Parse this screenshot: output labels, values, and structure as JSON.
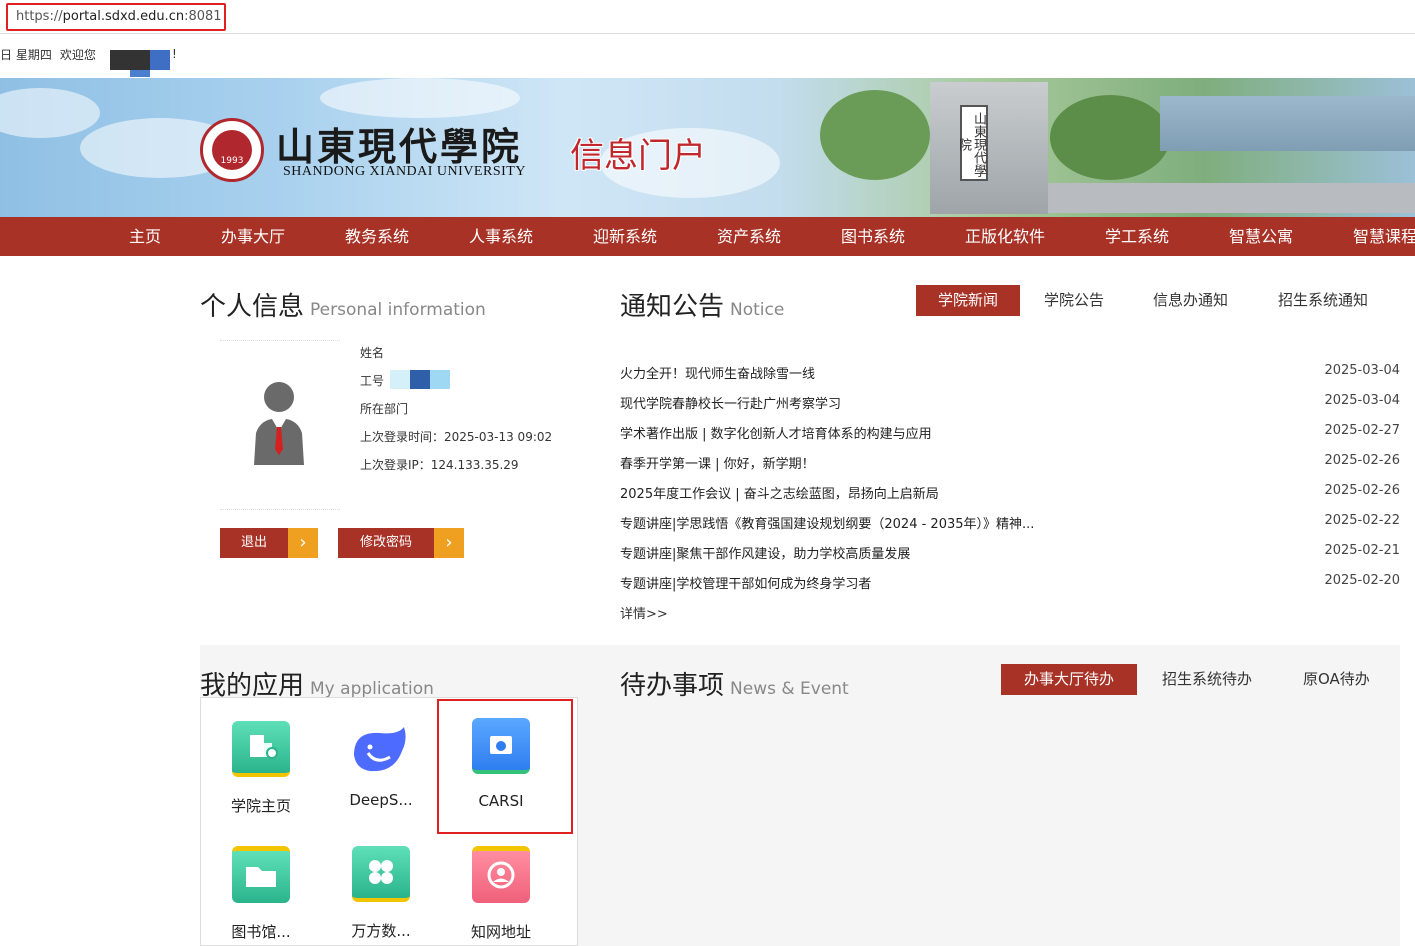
{
  "browser": {
    "url_scheme": "https://",
    "url_host": "portal.sdxd.edu.cn",
    "url_port": ":8081"
  },
  "welcome": {
    "weekday": "日 星期四",
    "greeting": "欢迎您",
    "exclaim": "!"
  },
  "banner": {
    "school_cn": "山東現代學院",
    "school_en": "SHANDONG XIANDAI UNIVERSITY",
    "seal_year": "1993",
    "portal_title": "信息门户",
    "gate_plaque": "山東現代學院"
  },
  "nav": [
    "主页",
    "办事大厅",
    "教务系统",
    "人事系统",
    "迎新系统",
    "资产系统",
    "图书系统",
    "正版化软件",
    "学工系统",
    "智慧公寓",
    "智慧课程"
  ],
  "personal": {
    "title": "个人信息",
    "title_en": "Personal information",
    "name_label": "姓名",
    "id_label": "工号",
    "dept_label": "所在部门",
    "last_login_time": "上次登录时间：2025-03-13 09:02",
    "last_login_ip": "上次登录IP：124.133.35.29",
    "logout": "退出",
    "change_password": "修改密码"
  },
  "notice": {
    "title": "通知公告",
    "title_en": "Notice",
    "tabs": [
      "学院新闻",
      "学院公告",
      "信息办通知",
      "招生系统通知"
    ],
    "items": [
      {
        "title": "火力全开！现代师生奋战除雪一线",
        "date": "2025-03-04"
      },
      {
        "title": "现代学院春静校长一行赴广州考察学习",
        "date": "2025-03-04"
      },
      {
        "title": "学术著作出版 | 数字化创新人才培育体系的构建与应用",
        "date": "2025-02-27"
      },
      {
        "title": "春季开学第一课 | 你好，新学期！",
        "date": "2025-02-26"
      },
      {
        "title": "2025年度工作会议 | 奋斗之志绘蓝图，昂扬向上启新局",
        "date": "2025-02-26"
      },
      {
        "title": "专题讲座|学思践悟《教育强国建设规划纲要（2024 - 2035年）》精神...",
        "date": "2025-02-22"
      },
      {
        "title": "专题讲座|聚焦干部作风建设，助力学校高质量发展",
        "date": "2025-02-21"
      },
      {
        "title": "专题讲座|学校管理干部如何成为终身学习者",
        "date": "2025-02-20"
      }
    ],
    "more": "详情>>"
  },
  "apps": {
    "title": "我的应用",
    "title_en": "My application",
    "items": [
      {
        "name": "学院主页",
        "icon": "building-icon",
        "color": "#3cc8a0"
      },
      {
        "name": "DeepS...",
        "icon": "whale-icon",
        "color": "#4d6bfe"
      },
      {
        "name": "CARSI",
        "icon": "folder-globe-icon",
        "color": "#2f8cff"
      },
      {
        "name": "图书馆...",
        "icon": "folder-icon",
        "color": "#3cc8a0"
      },
      {
        "name": "万方数...",
        "icon": "grid-icon",
        "color": "#3cc8a0"
      },
      {
        "name": "知网地址",
        "icon": "people-icon",
        "color": "#f0607a"
      }
    ]
  },
  "todo": {
    "title": "待办事项",
    "title_en": "News & Event",
    "tabs": [
      "办事大厅待办",
      "招生系统待办",
      "原OA待办"
    ]
  },
  "colors": {
    "brand_red": "#a93226",
    "accent_orange": "#f0a020",
    "highlight_red": "#e02020"
  }
}
